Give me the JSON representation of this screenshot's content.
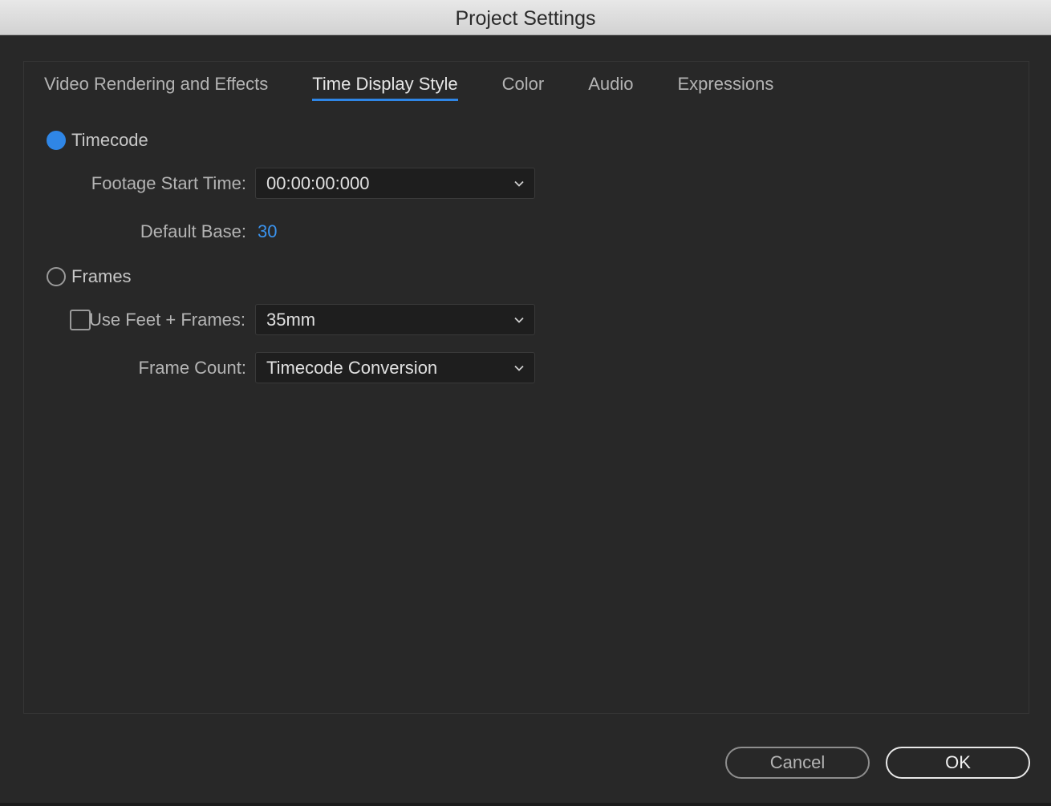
{
  "window": {
    "title": "Project Settings"
  },
  "tabs": [
    {
      "label": "Video Rendering and Effects",
      "active": false
    },
    {
      "label": "Time Display Style",
      "active": true
    },
    {
      "label": "Color",
      "active": false
    },
    {
      "label": "Audio",
      "active": false
    },
    {
      "label": "Expressions",
      "active": false
    }
  ],
  "timecode": {
    "label": "Timecode",
    "selected": true,
    "footage_start_time": {
      "label": "Footage Start Time:",
      "value": "00:00:00:000"
    },
    "default_base": {
      "label": "Default Base:",
      "value": "30"
    }
  },
  "frames": {
    "label": "Frames",
    "selected": false,
    "use_feet_frames": {
      "label": "Use Feet + Frames:",
      "checked": false,
      "value": "35mm"
    },
    "frame_count": {
      "label": "Frame Count:",
      "value": "Timecode Conversion"
    }
  },
  "buttons": {
    "cancel": "Cancel",
    "ok": "OK"
  },
  "colors": {
    "accent": "#2f86e6",
    "background": "#282828",
    "titlebar": "#dcdcdc"
  },
  "icons": {
    "dropdown": "chevron-down-icon"
  }
}
